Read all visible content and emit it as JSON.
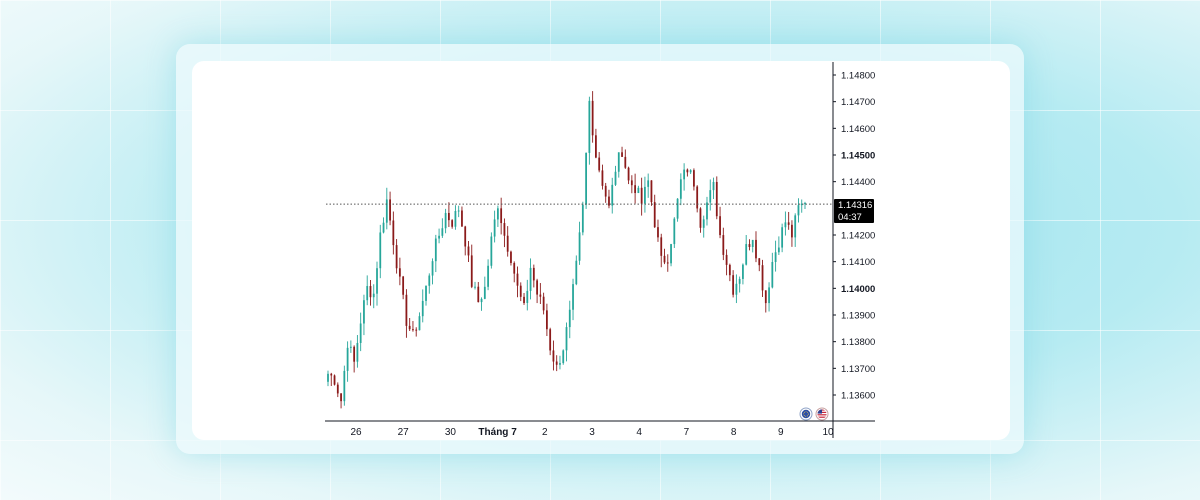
{
  "chart_data": {
    "type": "candlestick",
    "y_ticks": [
      {
        "label": "1.14800",
        "value": 1.148,
        "bold": false
      },
      {
        "label": "1.14700",
        "value": 1.147,
        "bold": false
      },
      {
        "label": "1.14600",
        "value": 1.146,
        "bold": false
      },
      {
        "label": "1.14500",
        "value": 1.145,
        "bold": true
      },
      {
        "label": "1.14400",
        "value": 1.144,
        "bold": false
      },
      {
        "label": "1.14200",
        "value": 1.142,
        "bold": false
      },
      {
        "label": "1.14100",
        "value": 1.141,
        "bold": false
      },
      {
        "label": "1.14000",
        "value": 1.14,
        "bold": true
      },
      {
        "label": "1.13900",
        "value": 1.139,
        "bold": false
      },
      {
        "label": "1.13800",
        "value": 1.138,
        "bold": false
      },
      {
        "label": "1.13700",
        "value": 1.137,
        "bold": false
      },
      {
        "label": "1.13600",
        "value": 1.136,
        "bold": false
      }
    ],
    "x_ticks": [
      {
        "label": "26",
        "bold": false
      },
      {
        "label": "27",
        "bold": false
      },
      {
        "label": "30",
        "bold": false
      },
      {
        "label": "Tháng 7",
        "bold": true
      },
      {
        "label": "2",
        "bold": false
      },
      {
        "label": "3",
        "bold": false
      },
      {
        "label": "4",
        "bold": false
      },
      {
        "label": "7",
        "bold": false
      },
      {
        "label": "8",
        "bold": false
      },
      {
        "label": "9",
        "bold": false
      },
      {
        "label": "10",
        "bold": false
      }
    ],
    "ylim": [
      1.1352,
      1.1485
    ],
    "current_price": {
      "value": 1.14316,
      "label": "1.14316",
      "countdown": "04:37"
    },
    "colors": {
      "up": "#26a69a",
      "down": "#8b1a1a",
      "axis": "#131722",
      "price_line": "#555555",
      "price_box": "#000000"
    },
    "close_path": [
      1.1368,
      1.1366,
      1.1358,
      1.138,
      1.1372,
      1.1388,
      1.14,
      1.1398,
      1.142,
      1.1433,
      1.1418,
      1.1402,
      1.1388,
      1.1382,
      1.139,
      1.14,
      1.1412,
      1.142,
      1.1428,
      1.1425,
      1.143,
      1.1418,
      1.1402,
      1.1395,
      1.14,
      1.1418,
      1.1432,
      1.142,
      1.1412,
      1.14,
      1.1392,
      1.1408,
      1.1398,
      1.1392,
      1.1378,
      1.137,
      1.1378,
      1.139,
      1.1408,
      1.143,
      1.147,
      1.145,
      1.144,
      1.143,
      1.1445,
      1.1452,
      1.144,
      1.1438,
      1.1432,
      1.144,
      1.1425,
      1.141,
      1.1412,
      1.1425,
      1.144,
      1.1445,
      1.144,
      1.1425,
      1.1432,
      1.1438,
      1.142,
      1.141,
      1.14,
      1.1405,
      1.1415,
      1.142,
      1.1408,
      1.1395,
      1.141,
      1.1418,
      1.1425,
      1.142,
      1.143,
      1.1432
    ],
    "flag_icons": [
      "eu-flag-icon",
      "us-flag-icon"
    ]
  }
}
